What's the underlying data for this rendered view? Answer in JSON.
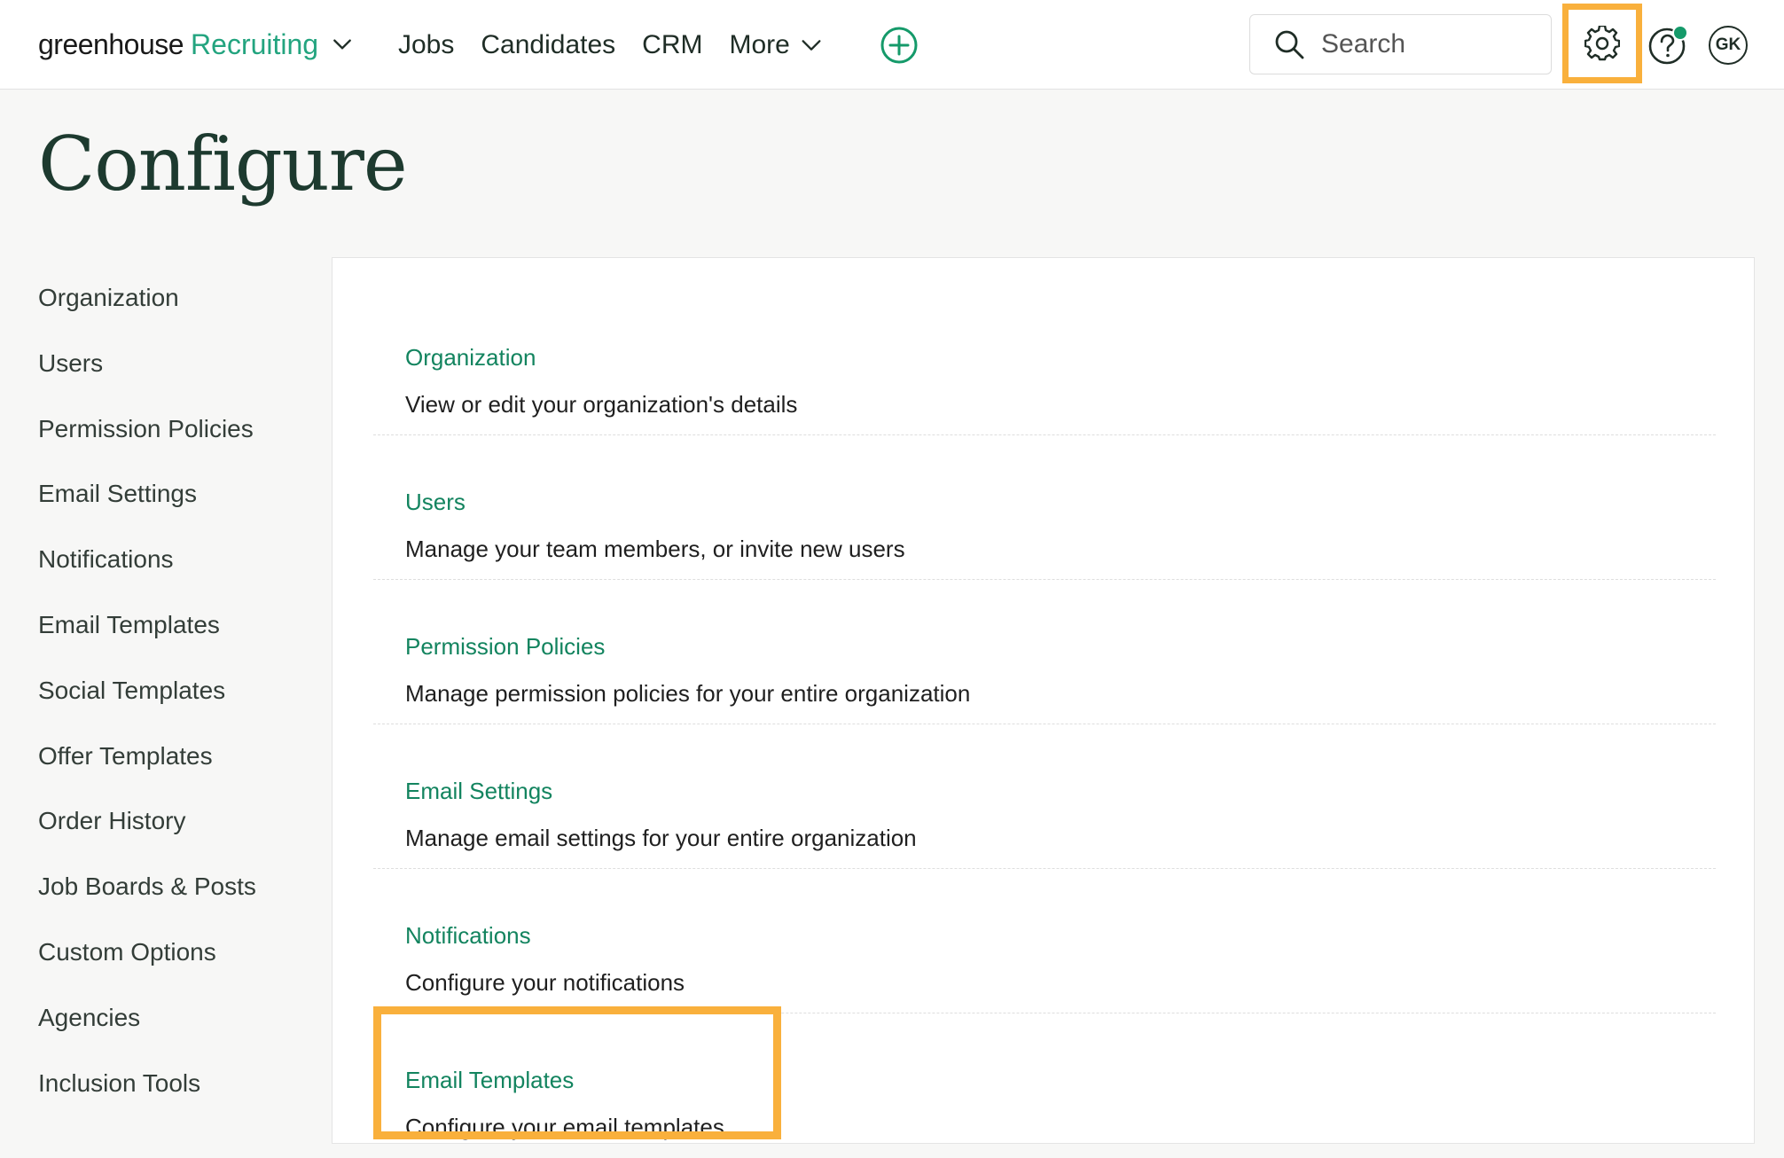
{
  "header": {
    "brand": "greenhouse",
    "product": "Recruiting",
    "nav": [
      {
        "label": "Jobs"
      },
      {
        "label": "Candidates"
      },
      {
        "label": "CRM"
      },
      {
        "label": "More"
      }
    ],
    "search_placeholder": "Search",
    "avatar_initials": "GK",
    "highlight_color": "#f9b03c",
    "accent_color": "#23a47f"
  },
  "page": {
    "title": "Configure"
  },
  "sidebar": {
    "items": [
      {
        "label": "Organization"
      },
      {
        "label": "Users"
      },
      {
        "label": "Permission Policies"
      },
      {
        "label": "Email Settings"
      },
      {
        "label": "Notifications"
      },
      {
        "label": "Email Templates"
      },
      {
        "label": "Social Templates"
      },
      {
        "label": "Offer Templates"
      },
      {
        "label": "Order History"
      },
      {
        "label": "Job Boards & Posts"
      },
      {
        "label": "Custom Options"
      },
      {
        "label": "Agencies"
      },
      {
        "label": "Inclusion Tools"
      }
    ]
  },
  "sections": [
    {
      "title": "Organization",
      "description": "View or edit your organization's details"
    },
    {
      "title": "Users",
      "description": "Manage your team members, or invite new users"
    },
    {
      "title": "Permission Policies",
      "description": "Manage permission policies for your entire organization"
    },
    {
      "title": "Email Settings",
      "description": "Manage email settings for your entire organization"
    },
    {
      "title": "Notifications",
      "description": "Configure your notifications"
    },
    {
      "title": "Email Templates",
      "description": "Configure your email templates"
    }
  ]
}
